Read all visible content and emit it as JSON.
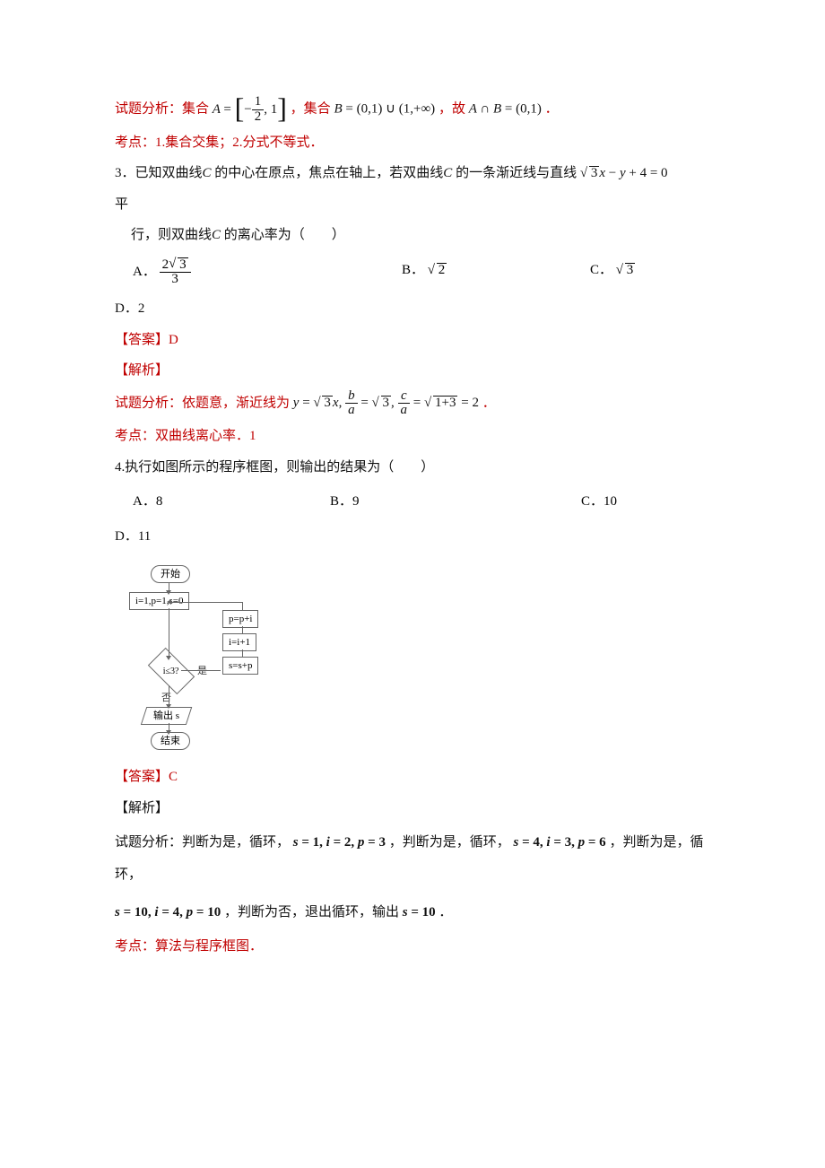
{
  "q2": {
    "analysis_prefix": "试题分析：集合 ",
    "setA_expr": "A = [ −1/2 , 1 ]",
    "mid_text1": "，集合 ",
    "setB_expr": "B = (0,1) ∪ (1,+∞)",
    "mid_text2": "，故 ",
    "result_expr": "A ∩ B = (0,1)",
    "period": "．",
    "kaodian": "考点：1.集合交集；2.分式不等式．"
  },
  "q3": {
    "stem1": "3．已知双曲线",
    "C1": "C",
    "stem1b": "的中心在原点，焦点在轴上，若双曲线",
    "C2": "C",
    "stem1c": "的一条渐近线与直线",
    "line_expr": "√3·x − y + 4 = 0",
    "stem2a": "平",
    "stem2b": "行，则双曲线",
    "C3": "C",
    "stem2c": "的离心率为（　　）",
    "optA_label": "A．",
    "optA_val": "2√3 / 3",
    "optB_label": "B．",
    "optB_val": "√2",
    "optC_label": "C．",
    "optC_val": "√3",
    "optD": "D．2",
    "answer": "【答案】D",
    "jiexi": "【解析】",
    "analysis_prefix": "试题分析：依题意，渐近线为 ",
    "analysis_expr": "y = √3·x,  b/a = √3,  c/a = √(1+3) = 2",
    "period": "．",
    "kaodian": "考点：双曲线离心率．1"
  },
  "q4": {
    "stem": "4.执行如图所示的程序框图，则输出的结果为（　　）",
    "optA": "A．8",
    "optB": "B．9",
    "optC": "C．10",
    "optD": "D．11",
    "flow": {
      "start": "开始",
      "init": "i=1,p=1,s=0",
      "cond": "i≤3?",
      "yes": "是",
      "no": "否",
      "step1": "p=p+i",
      "step2": "i=i+1",
      "step3": "s=s+p",
      "out": "输出 s",
      "end": "结束"
    },
    "answer": "【答案】C",
    "jiexi": "【解析】",
    "analysis_a": "试题分析：判断为是，循环，",
    "loop1": "s = 1, i = 2, p = 3",
    "analysis_b": "，判断为是，循环，",
    "loop2": "s = 4, i = 3, p = 6",
    "analysis_c": "，判断为是，循环，",
    "loop3": "s = 10, i = 4, p = 10",
    "analysis_d": "，判断为否，退出循环，输出",
    "final": "s = 10",
    "analysis_e": "．",
    "kaodian": "考点：算法与程序框图．"
  },
  "chart_data": {
    "type": "flowchart",
    "nodes": [
      {
        "id": "start",
        "shape": "terminator",
        "text": "开始"
      },
      {
        "id": "init",
        "shape": "process",
        "text": "i=1, p=1, s=0"
      },
      {
        "id": "cond",
        "shape": "decision",
        "text": "i ≤ 3?"
      },
      {
        "id": "step1",
        "shape": "process",
        "text": "p = p + i"
      },
      {
        "id": "step2",
        "shape": "process",
        "text": "i = i + 1"
      },
      {
        "id": "step3",
        "shape": "process",
        "text": "s = s + p"
      },
      {
        "id": "out",
        "shape": "io",
        "text": "输出 s"
      },
      {
        "id": "end",
        "shape": "terminator",
        "text": "结束"
      }
    ],
    "edges": [
      {
        "from": "start",
        "to": "init"
      },
      {
        "from": "init",
        "to": "cond"
      },
      {
        "from": "cond",
        "to": "step3",
        "label": "是"
      },
      {
        "from": "step3",
        "to": "step2"
      },
      {
        "from": "step2",
        "to": "step1"
      },
      {
        "from": "step1",
        "to": "cond",
        "note": "loop back"
      },
      {
        "from": "cond",
        "to": "out",
        "label": "否"
      },
      {
        "from": "out",
        "to": "end"
      }
    ]
  }
}
